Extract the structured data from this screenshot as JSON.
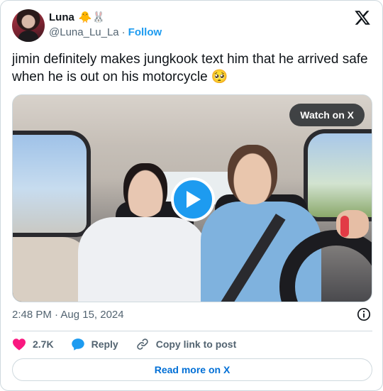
{
  "author": {
    "display_name": "Luna",
    "name_emojis": "🐥🐰",
    "handle": "@Luna_Lu_La",
    "separator": "·",
    "follow_label": "Follow"
  },
  "tweet": {
    "text": "jimin definitely makes jungkook text him that he arrived safe when he is out on his motorcycle 🥺",
    "timestamp": "2:48 PM · Aug 15, 2024"
  },
  "media": {
    "watch_label": "Watch on X",
    "icon": "play-icon"
  },
  "actions": {
    "like_count": "2.7K",
    "reply_label": "Reply",
    "copy_label": "Copy link to post"
  },
  "read_more_label": "Read more on X",
  "colors": {
    "accent": "#1d9bf0",
    "like": "#f91880",
    "reply": "#1d9bf0",
    "link_text": "#006fd6",
    "muted": "#536471"
  }
}
